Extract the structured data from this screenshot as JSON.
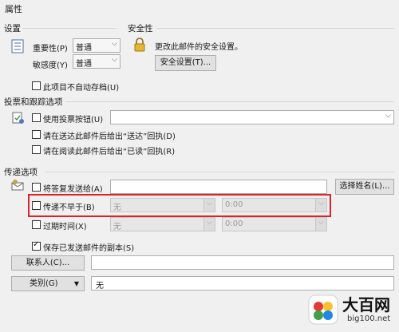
{
  "window": {
    "title": "属性"
  },
  "settings": {
    "section_title": "设置",
    "importance_label": "重要性(P)",
    "importance_value": "普通",
    "sensitivity_label": "敏感度(Y)",
    "sensitivity_value": "普通",
    "no_autoarchive_label": "此项目不自动存档(U)"
  },
  "security": {
    "section_title": "安全性",
    "description": "更改此邮件的安全设置。",
    "settings_button": "安全设置(T)..."
  },
  "voting": {
    "section_title": "投票和跟踪选项",
    "use_voting_label": "使用投票按钮(U)",
    "delivery_receipt_label": "请在送达此邮件后给出“送达”回执(D)",
    "read_receipt_label": "请在阅读此邮件后给出“已读”回执(R)"
  },
  "delivery": {
    "section_title": "传递选项",
    "reply_to_label": "将答复发送给(A)",
    "select_names_button": "选择姓名(L)...",
    "do_not_deliver_label": "传递不早于(B)",
    "do_not_deliver_date": "无",
    "do_not_deliver_time": "0:00",
    "expires_label": "过期时间(X)",
    "expires_date": "无",
    "expires_time": "0:00",
    "save_copy_label": "保存已发送邮件的副本(S)"
  },
  "contacts": {
    "button": "联系人(C)..."
  },
  "categories": {
    "button": "类别(G)",
    "value": "无"
  },
  "watermark": {
    "brand": "大百网",
    "url": "big100.net"
  },
  "colors": {
    "highlight": "#d9232e"
  }
}
